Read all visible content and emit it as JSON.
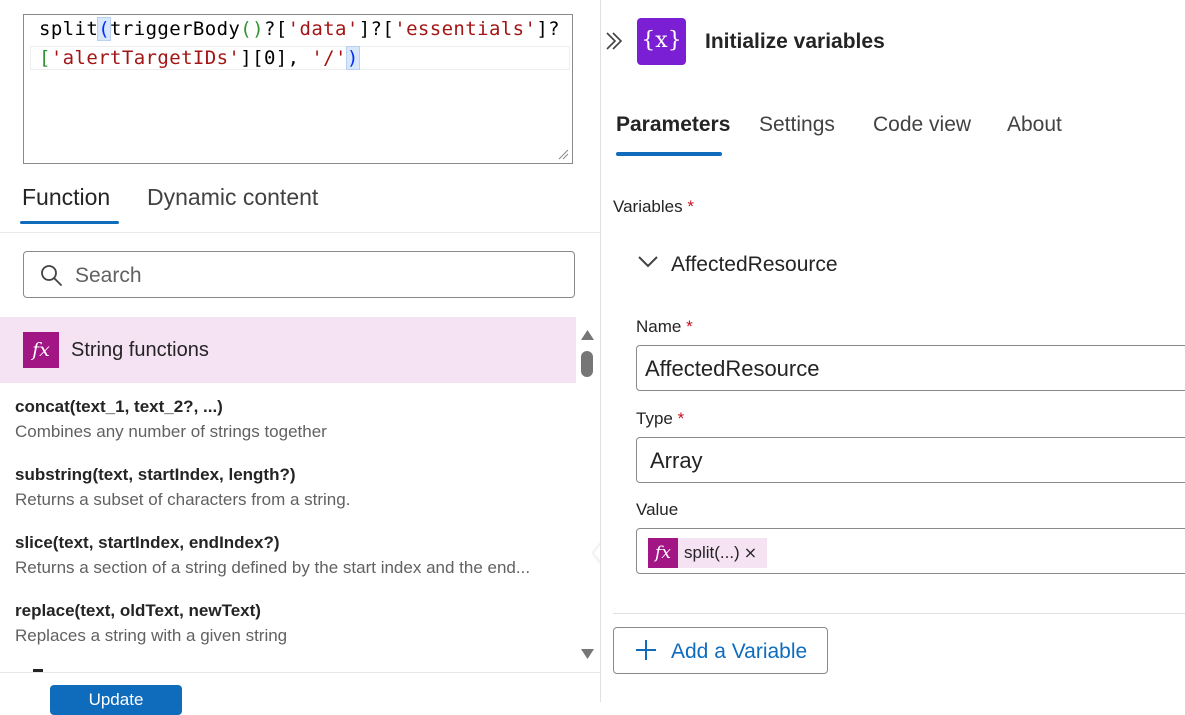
{
  "editor": {
    "line1": {
      "fn": "split",
      "p1": "(",
      "trig": "triggerBody",
      "p2": "()",
      "q1": "?[",
      "s1": "'data'",
      "q2": "]?[",
      "s2": "'essentials'",
      "q3": "]?"
    },
    "line2": {
      "b1": "[",
      "s3": "'alertTargetIDs'",
      "b2": "][0], ",
      "s4": "'/'",
      "p3": ")"
    }
  },
  "left_tabs": {
    "function": "Function",
    "dynamic": "Dynamic content"
  },
  "search": {
    "placeholder": "Search"
  },
  "category": {
    "icon": "fx",
    "label": "String functions"
  },
  "functions": [
    {
      "signature": "concat(text_1, text_2?, ...)",
      "description": "Combines any number of strings together"
    },
    {
      "signature": "substring(text, startIndex, length?)",
      "description": "Returns a subset of characters from a string."
    },
    {
      "signature": "slice(text, startIndex, endIndex?)",
      "description": "Returns a section of a string defined by the start index and the end..."
    },
    {
      "signature": "replace(text, oldText, newText)",
      "description": "Replaces a string with a given string"
    }
  ],
  "update_button": "Update",
  "action": {
    "icon": "{x}",
    "title": "Initialize variables"
  },
  "right_tabs": {
    "parameters": "Parameters",
    "settings": "Settings",
    "code_view": "Code view",
    "about": "About"
  },
  "variables_label": "Variables",
  "required_mark": "*",
  "variable": {
    "header": "AffectedResource",
    "name_label": "Name",
    "name_value": "AffectedResource",
    "type_label": "Type",
    "type_value": "Array",
    "value_label": "Value",
    "value_token": {
      "icon": "fx",
      "label": "split(...)",
      "remove": "×"
    }
  },
  "add_variable": "Add a Variable",
  "colors": {
    "accent": "#0f6cbd",
    "fx": "#a21584",
    "variables_icon": "#7b1fd4",
    "category_bg": "#f5e3f3"
  }
}
